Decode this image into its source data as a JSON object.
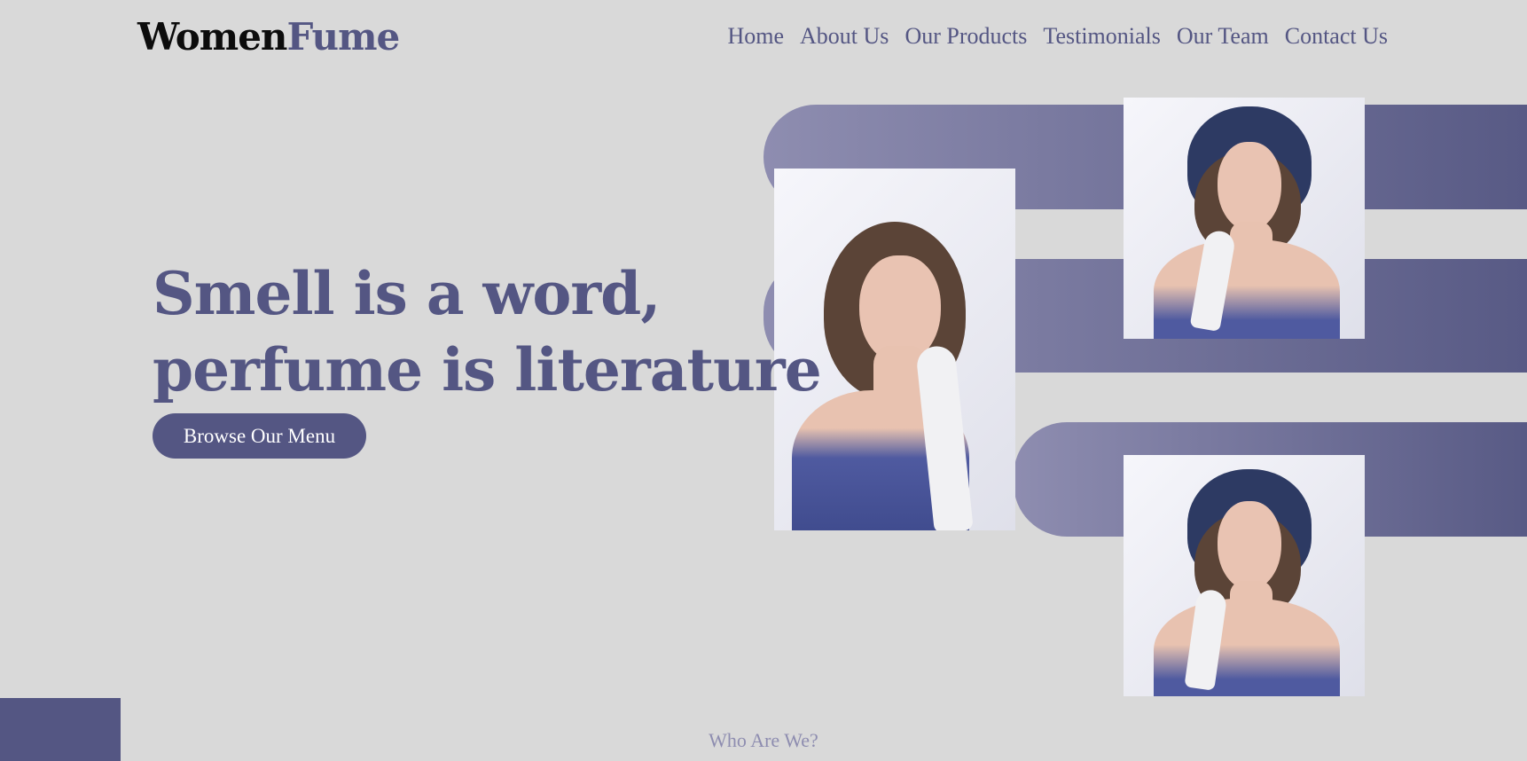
{
  "brand": {
    "part1": "Women",
    "part2": "Fume"
  },
  "nav": [
    "Home",
    "About Us",
    "Our Products",
    "Testimonials",
    "Our Team",
    "Contact Us"
  ],
  "hero": {
    "headline_line1": "Smell is a word,",
    "headline_line2": "perfume is literature",
    "cta": "Browse Our Menu"
  },
  "section_next": {
    "title": "Who Are We?"
  },
  "colors": {
    "accent": "#545683",
    "accent_light": "#8e8db0",
    "background": "#d9d9d9",
    "logo_dark": "#0c0c0c"
  },
  "images": [
    "woman-with-glove-photo",
    "woman-with-headscarf-photo",
    "woman-with-headscarf-eyes-closed-photo"
  ]
}
